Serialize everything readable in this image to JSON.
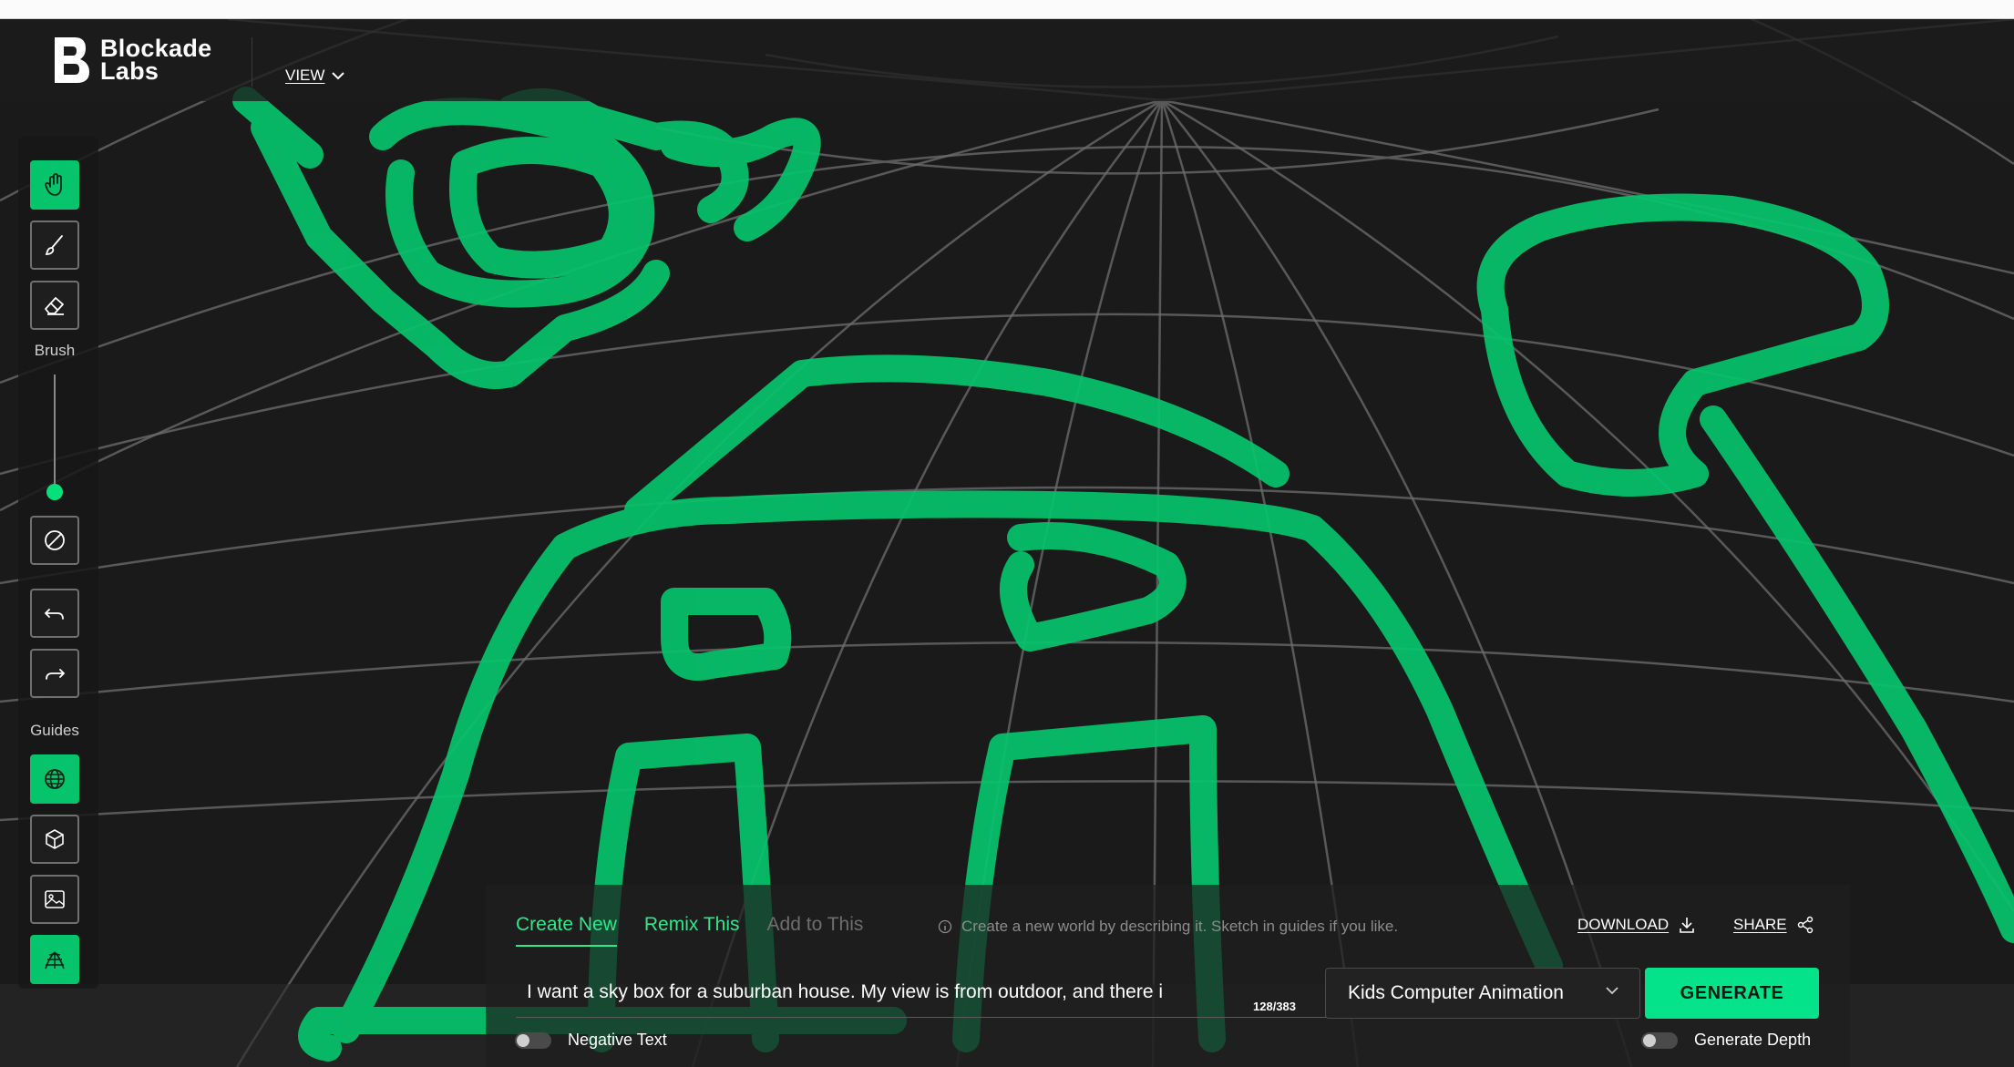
{
  "app": {
    "brand_line1": "Blockade",
    "brand_line2": "Labs",
    "view_menu_label": "VIEW"
  },
  "toolbar": {
    "brush_label": "Brush",
    "guides_label": "Guides",
    "tools": [
      {
        "name": "pan",
        "icon": "hand-icon",
        "active": true
      },
      {
        "name": "brush",
        "icon": "brush-icon",
        "active": false
      },
      {
        "name": "eraser",
        "icon": "eraser-icon",
        "active": false
      },
      {
        "name": "clear",
        "icon": "clear-icon",
        "active": false
      },
      {
        "name": "undo",
        "icon": "undo-icon",
        "active": false
      },
      {
        "name": "redo",
        "icon": "redo-icon",
        "active": false
      }
    ],
    "guides": [
      {
        "name": "sphere-guide",
        "icon": "globe-icon",
        "active": true
      },
      {
        "name": "cube-guide",
        "icon": "cube-icon",
        "active": false
      },
      {
        "name": "image-guide",
        "icon": "image-icon",
        "active": false
      },
      {
        "name": "floor-guide",
        "icon": "floor-grid-icon",
        "active": true
      }
    ],
    "brush_size_fraction": 0.05
  },
  "prompt": {
    "tabs": [
      {
        "label": "Create New",
        "state": "active"
      },
      {
        "label": "Remix This",
        "state": "enabled"
      },
      {
        "label": "Add to This",
        "state": "disabled"
      }
    ],
    "hint": "Create a new world by describing it. Sketch in guides if you like.",
    "download_label": "DOWNLOAD",
    "share_label": "SHARE",
    "input_value": "I want a sky box for a suburban house. My view is from outdoor, and there i",
    "char_count": "128/383",
    "style_value": "Kids Computer Animation",
    "generate_label": "GENERATE",
    "negative_text_label": "Negative Text",
    "generate_depth_label": "Generate Depth"
  },
  "colors": {
    "accent": "#05e38a",
    "sketch": "#05c46b",
    "background": "#161616",
    "panel": "#1e1e1e"
  }
}
